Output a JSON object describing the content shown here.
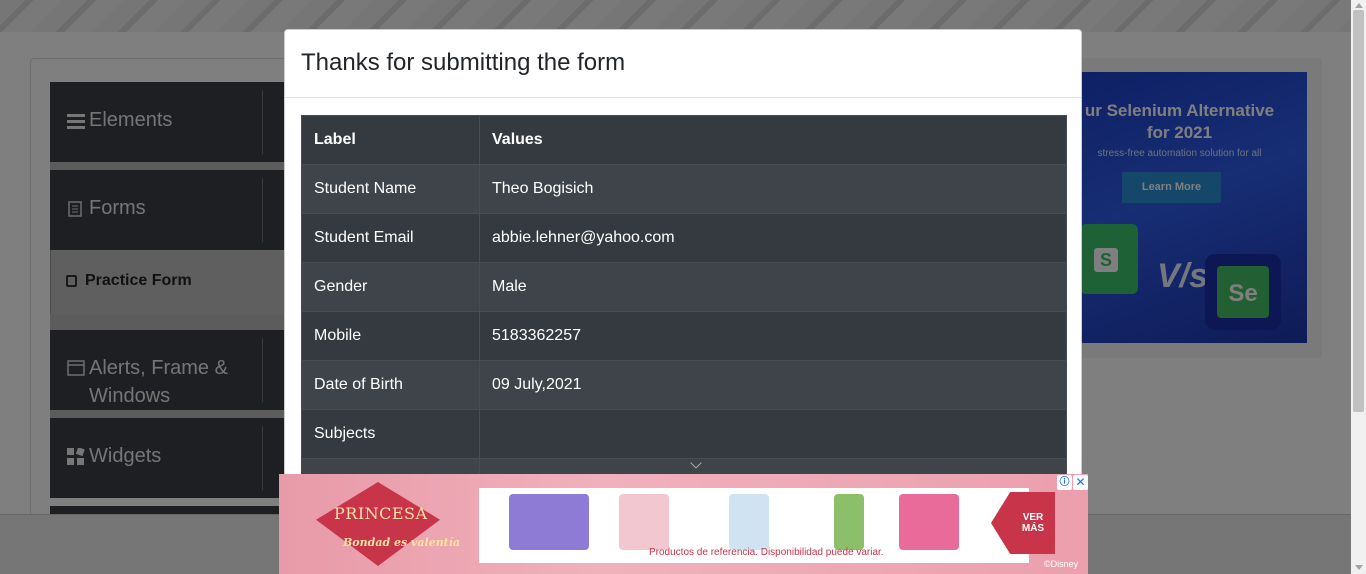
{
  "sidebar": {
    "groups": [
      {
        "label": "Elements",
        "icon": "hamburger-icon"
      },
      {
        "label": "Forms",
        "icon": "document-icon"
      },
      {
        "label": "Alerts, Frame &\nWindows",
        "icon": "window-icon"
      },
      {
        "label": "Widgets",
        "icon": "widgets-icon"
      }
    ],
    "active_item": {
      "label": "Practice Form",
      "icon": "clipboard-icon"
    }
  },
  "ad_right": {
    "title": "ur Selenium Alternative for 2021",
    "subtitle": "stress-free automation solution for all",
    "button": "Learn More",
    "vs": "V/s",
    "se": "Se",
    "s": "S"
  },
  "modal": {
    "title": "Thanks for submitting the form",
    "table": {
      "headers": [
        "Label",
        "Values"
      ],
      "rows": [
        [
          "Student Name",
          "Theo Bogisich"
        ],
        [
          "Student Email",
          "abbie.lehner@yahoo.com"
        ],
        [
          "Gender",
          "Male"
        ],
        [
          "Mobile",
          "5183362257"
        ],
        [
          "Date of Birth",
          "09 July,2021"
        ],
        [
          "Subjects",
          ""
        ]
      ]
    }
  },
  "ad_bottom": {
    "brand": "PRINCESA",
    "tagline": "Bondad es valentía",
    "caption": "Productos de referencia. Disponibilidad puede variar.",
    "cta": "VER MÁS",
    "copyright": "©Disney",
    "info": "ⓘ",
    "close": "✕"
  },
  "colors": {
    "sidebar_bg": "#3a3f44",
    "table_dark": "#343a40",
    "table_striped": "#3e444a",
    "ad_blue": "#2f5be8",
    "ad_pink": "#e89aa8"
  }
}
